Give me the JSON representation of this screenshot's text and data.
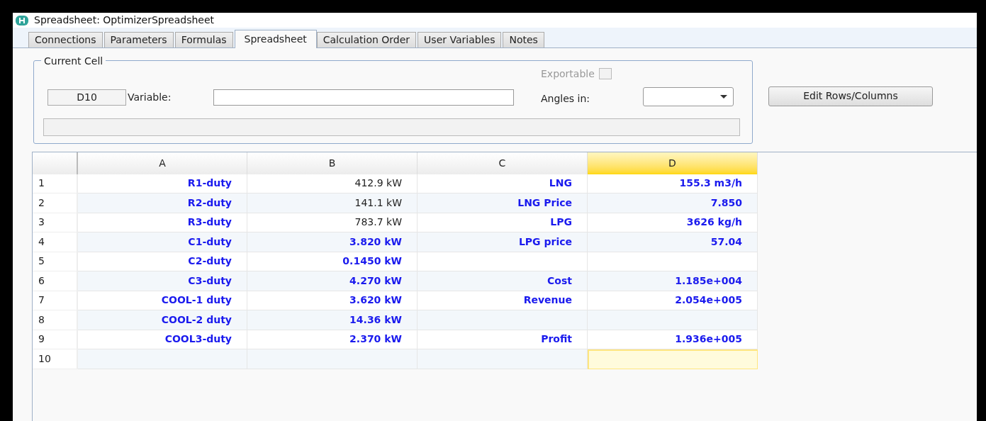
{
  "window": {
    "title": "Spreadsheet: OptimizerSpreadsheet"
  },
  "tabs": [
    {
      "label": "Connections",
      "selected": false
    },
    {
      "label": "Parameters",
      "selected": false
    },
    {
      "label": "Formulas",
      "selected": false
    },
    {
      "label": "Spreadsheet",
      "selected": true
    },
    {
      "label": "Calculation Order",
      "selected": false
    },
    {
      "label": "User Variables",
      "selected": false
    },
    {
      "label": "Notes",
      "selected": false
    }
  ],
  "current_cell": {
    "legend": "Current Cell",
    "address": "D10",
    "variable_label": "Variable:",
    "exportable_label": "Exportable",
    "exportable_checked": false,
    "angles_label": "Angles in:"
  },
  "edit_button": "Edit Rows/Columns",
  "grid": {
    "columns": [
      {
        "label": "A",
        "selected": false
      },
      {
        "label": "B",
        "selected": false
      },
      {
        "label": "C",
        "selected": false
      },
      {
        "label": "D",
        "selected": true
      }
    ],
    "rows": [
      {
        "label": "1",
        "cells": [
          {
            "text": "R1-duty",
            "kind": "entered",
            "selected": false
          },
          {
            "text": "412.9 kW",
            "kind": "plain",
            "selected": false
          },
          {
            "text": "LNG",
            "kind": "entered",
            "selected": false
          },
          {
            "text": "155.3 m3/h",
            "kind": "entered",
            "selected": false
          }
        ]
      },
      {
        "label": "2",
        "cells": [
          {
            "text": "R2-duty",
            "kind": "entered",
            "selected": false
          },
          {
            "text": "141.1 kW",
            "kind": "plain",
            "selected": false
          },
          {
            "text": "LNG Price",
            "kind": "entered",
            "selected": false
          },
          {
            "text": "7.850",
            "kind": "entered",
            "selected": false
          }
        ]
      },
      {
        "label": "3",
        "cells": [
          {
            "text": "R3-duty",
            "kind": "entered",
            "selected": false
          },
          {
            "text": "783.7 kW",
            "kind": "plain",
            "selected": false
          },
          {
            "text": "LPG",
            "kind": "entered",
            "selected": false
          },
          {
            "text": "3626 kg/h",
            "kind": "entered",
            "selected": false
          }
        ]
      },
      {
        "label": "4",
        "cells": [
          {
            "text": "C1-duty",
            "kind": "entered",
            "selected": false
          },
          {
            "text": "3.820 kW",
            "kind": "entered",
            "selected": false
          },
          {
            "text": "LPG price",
            "kind": "entered",
            "selected": false
          },
          {
            "text": "57.04",
            "kind": "entered",
            "selected": false
          }
        ]
      },
      {
        "label": "5",
        "cells": [
          {
            "text": "C2-duty",
            "kind": "entered",
            "selected": false
          },
          {
            "text": "0.1450 kW",
            "kind": "entered",
            "selected": false
          },
          {
            "selected": false
          },
          {
            "selected": false
          }
        ]
      },
      {
        "label": "6",
        "cells": [
          {
            "text": "C3-duty",
            "kind": "entered",
            "selected": false
          },
          {
            "text": "4.270 kW",
            "kind": "entered",
            "selected": false
          },
          {
            "text": "Cost",
            "kind": "entered",
            "selected": false
          },
          {
            "text": "1.185e+004",
            "kind": "entered",
            "selected": false
          }
        ]
      },
      {
        "label": "7",
        "cells": [
          {
            "text": "COOL-1 duty",
            "kind": "entered",
            "selected": false
          },
          {
            "text": "3.620 kW",
            "kind": "entered",
            "selected": false
          },
          {
            "text": "Revenue",
            "kind": "entered",
            "selected": false
          },
          {
            "text": "2.054e+005",
            "kind": "entered",
            "selected": false
          }
        ]
      },
      {
        "label": "8",
        "cells": [
          {
            "text": "COOL-2 duty",
            "kind": "entered",
            "selected": false
          },
          {
            "text": "14.36 kW",
            "kind": "entered",
            "selected": false
          },
          {
            "selected": false
          },
          {
            "selected": false
          }
        ]
      },
      {
        "label": "9",
        "cells": [
          {
            "text": "COOL3-duty",
            "kind": "entered",
            "selected": false
          },
          {
            "text": "2.370 kW",
            "kind": "entered",
            "selected": false
          },
          {
            "text": "Profit",
            "kind": "entered",
            "selected": false
          },
          {
            "text": "1.936e+005",
            "kind": "entered",
            "selected": false
          }
        ]
      },
      {
        "label": "10",
        "cells": [
          {
            "selected": false
          },
          {
            "selected": false
          },
          {
            "selected": false
          },
          {
            "selected": true
          }
        ]
      }
    ]
  }
}
